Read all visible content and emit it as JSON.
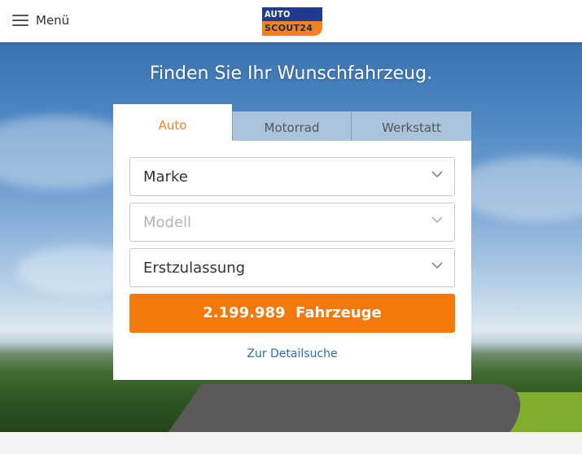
{
  "header": {
    "menu_label": "Menü",
    "logo_top": "AUTO",
    "logo_bottom": "SCOUT24"
  },
  "hero": {
    "headline": "Finden Sie Ihr Wunschfahrzeug."
  },
  "search": {
    "tabs": [
      {
        "label": "Auto",
        "active": true
      },
      {
        "label": "Motorrad",
        "active": false
      },
      {
        "label": "Werkstatt",
        "active": false
      }
    ],
    "fields": [
      {
        "label": "Marke",
        "disabled": false
      },
      {
        "label": "Modell",
        "disabled": true
      },
      {
        "label": "Erstzulassung",
        "disabled": false
      }
    ],
    "cta_label": "2.199.989  Fahrzeuge",
    "detail_link": "Zur Detailsuche"
  },
  "colors": {
    "accent_orange": "#f5780a",
    "brand_blue": "#1f3a8f",
    "link_blue": "#2a6ead"
  }
}
